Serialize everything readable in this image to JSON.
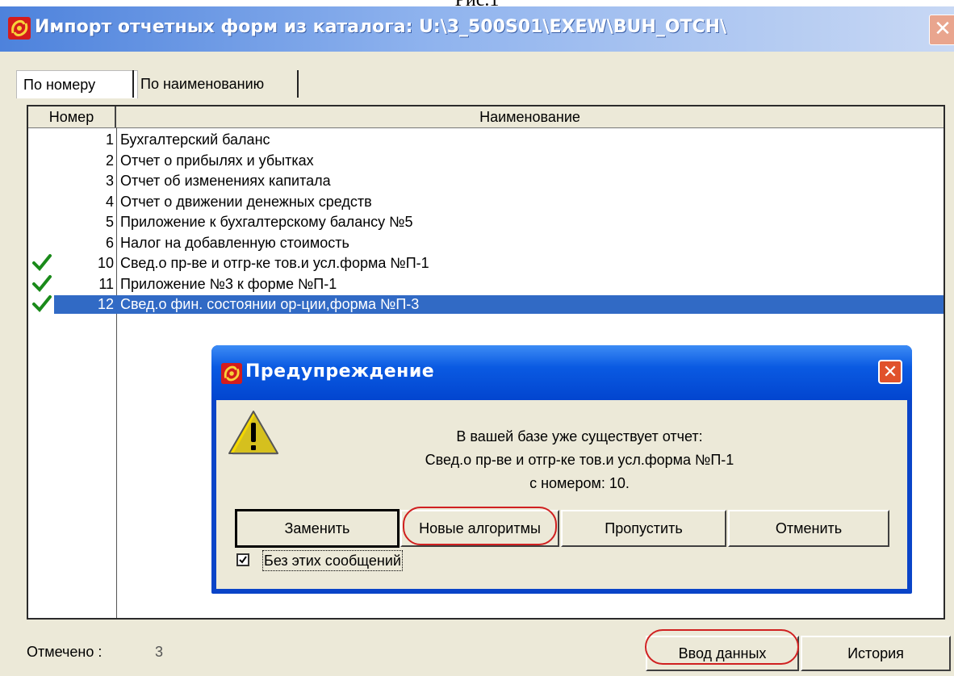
{
  "caption": "Рис.1",
  "window": {
    "title": "Импорт отчетных форм из каталога:  U:\\3_500S01\\EXEW\\BUH_OTCH\\",
    "close": "✕"
  },
  "tabs": [
    {
      "label": "По номеру"
    },
    {
      "label": "По наименованию"
    }
  ],
  "list": {
    "columns": {
      "number": "Номер",
      "name": "Наименование"
    },
    "rows": [
      {
        "num": "1",
        "name": "Бухгалтерский баланс",
        "checked": false
      },
      {
        "num": "2",
        "name": "Отчет о прибылях и убытках",
        "checked": false
      },
      {
        "num": "3",
        "name": "Отчет об изменениях капитала",
        "checked": false
      },
      {
        "num": "4",
        "name": "Отчет о движении денежных средств",
        "checked": false
      },
      {
        "num": "5",
        "name": "Приложение к бухгалтерскому балансу №5",
        "checked": false
      },
      {
        "num": "6",
        "name": "Налог на добавленную стоимость",
        "checked": false
      },
      {
        "num": "10",
        "name": "Свед.о пр-ве и отгр-ке тов.и усл.форма №П-1",
        "checked": true
      },
      {
        "num": "11",
        "name": "Приложение №3 к форме №П-1",
        "checked": true
      },
      {
        "num": "12",
        "name": "Свед.о фин. состоянии ор-ции,форма №П-3",
        "checked": true,
        "selected": true
      }
    ]
  },
  "status": {
    "label": "Отмечено :",
    "count": "3"
  },
  "buttons": {
    "data_entry": "Ввод данных",
    "history": "История"
  },
  "dialog": {
    "title": "Предупреждение",
    "close": "✕",
    "message": [
      "В вашей базе уже существует отчет:",
      "Свед.о пр-ве и отгр-ке тов.и усл.форма №П-1",
      "с номером: 10."
    ],
    "buttons": {
      "replace": "Заменить",
      "new_algorithms": "Новые алгоритмы",
      "skip": "Пропустить",
      "cancel": "Отменить"
    },
    "checkbox": {
      "label": "Без этих сообщений",
      "checked": true
    }
  },
  "colors": {
    "selection": "#316ac5",
    "check": "#1a8a1a",
    "annotation": "#d02020"
  }
}
